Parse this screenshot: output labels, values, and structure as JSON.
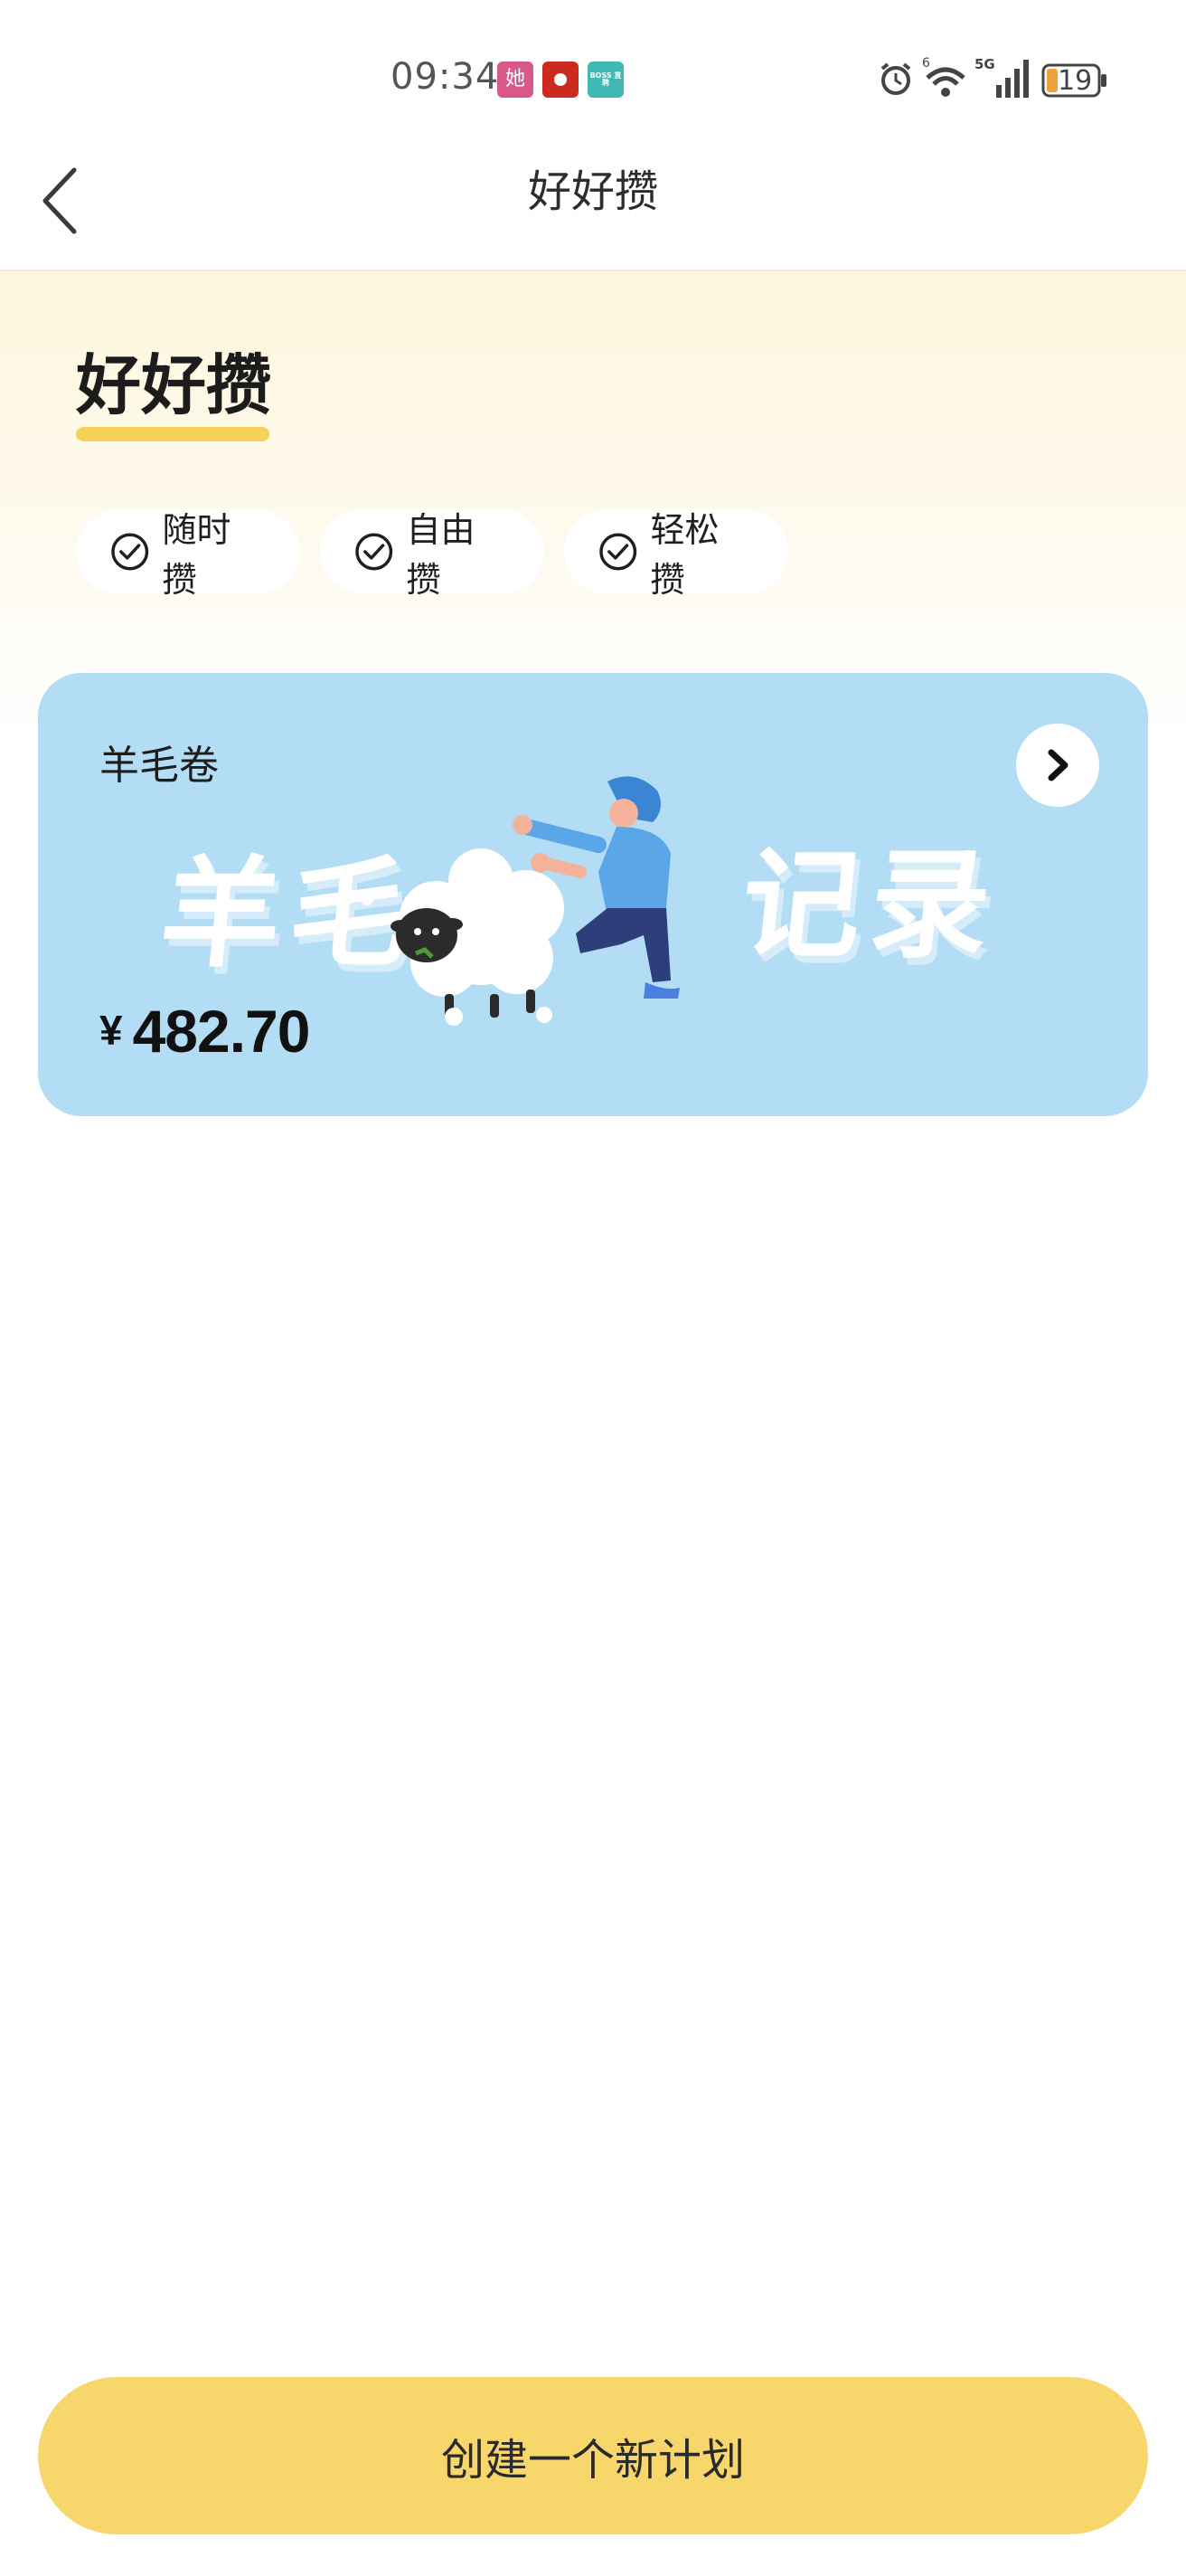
{
  "status_bar": {
    "time": "09:34",
    "apps": [
      "她",
      "",
      "BOSS 直聘"
    ],
    "battery": "19",
    "network_labels": [
      "6",
      "5G"
    ]
  },
  "nav": {
    "title": "好好攒"
  },
  "hero": {
    "title": "好好攒",
    "tags": [
      "随时攒",
      "自由攒",
      "轻松攒"
    ]
  },
  "card": {
    "name": "羊毛卷",
    "currency": "¥",
    "amount": "482.70",
    "banner_left": "羊毛",
    "banner_right": "记录"
  },
  "footer": {
    "create_label": "创建一个新计划"
  },
  "colors": {
    "accent": "#f7d66c",
    "card_bg": "#b2ddf5",
    "hero_bg": "#fdf6dd"
  }
}
